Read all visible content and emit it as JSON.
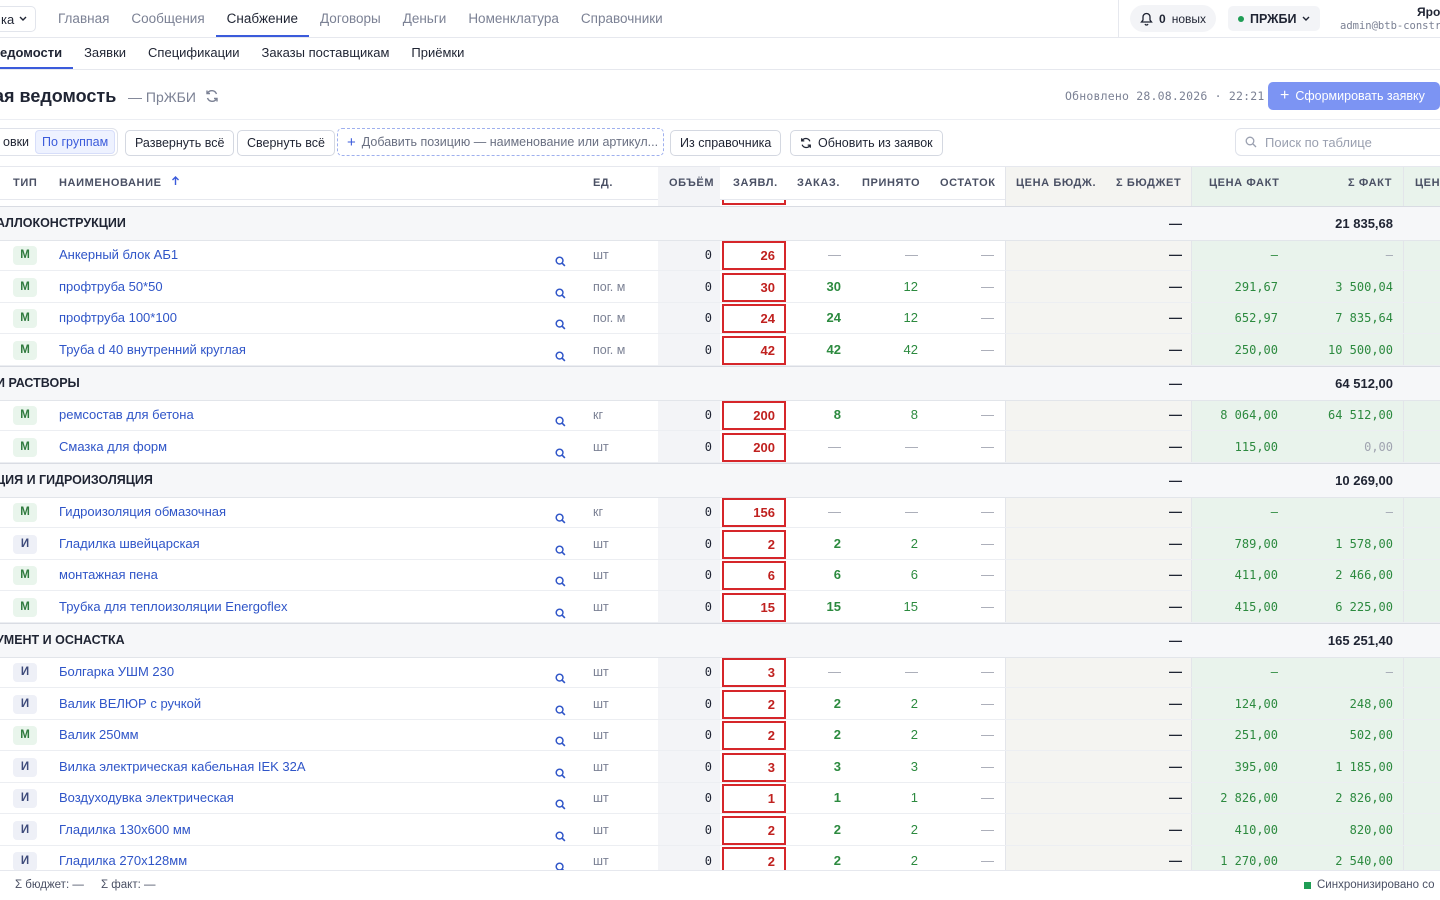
{
  "top_nav": {
    "project": "ка",
    "items": [
      "Главная",
      "Сообщения",
      "Снабжение",
      "Договоры",
      "Деньги",
      "Номенклатура",
      "Справочники"
    ],
    "active": "Снабжение",
    "notifications": {
      "count": "0",
      "label": "новых"
    },
    "org": "ПРЖБИ",
    "user_name": "Яро",
    "user_email": "admin@btb-constr"
  },
  "sub_nav": {
    "items": [
      "едомости",
      "Заявки",
      "Спецификации",
      "Заказы поставщикам",
      "Приёмки"
    ],
    "active": "едомости"
  },
  "header": {
    "title": "ая ведомость",
    "subtitle": "— ПрЖБИ",
    "updated_label": "Обновлено 28.08.2026 · 22:21",
    "primary_button": "Сформировать заявку"
  },
  "toolbar": {
    "group_toggle": [
      "овки",
      "По группам"
    ],
    "group_toggle_active": "По группам",
    "expand_all": "Развернуть всё",
    "collapse_all": "Свернуть всё",
    "add_placeholder": "Добавить позицию — наименование или артикул...",
    "from_catalog": "Из справочника",
    "update_from_requests": "Обновить из заявок",
    "search_placeholder": "Поиск по таблице"
  },
  "columns": {
    "type": "ТИП",
    "name": "НАИМЕНОВАНИЕ",
    "unit": "ЕД.",
    "volume": "ОБЪЁМ",
    "requested": "ЗАЯВЛ.",
    "ordered": "ЗАКАЗ.",
    "accepted": "ПРИНЯТО",
    "remainder": "ОСТАТОК",
    "price_budget": "ЦЕНА БЮДЖ.",
    "sum_budget": "Σ БЮДЖЕТ",
    "price_fact": "ЦЕНА ФАКТ",
    "sum_fact": "Σ ФАКТ",
    "price_next": "ЦЕН"
  },
  "groups": [
    {
      "name": "АЛЛОКОНСТРУКЦИИ",
      "budget": "—",
      "fact": "21 835,68",
      "rows": [
        {
          "type": "М",
          "name": "Анкерный блок АБ1",
          "unit": "шт",
          "volume": "0",
          "requested": "26",
          "ordered": "—",
          "accepted": "—",
          "remainder": "—",
          "budget": "—",
          "price_fact": "—",
          "sum_fact": "—"
        },
        {
          "type": "М",
          "name": "профтруба 50*50",
          "unit": "пог. м",
          "volume": "0",
          "requested": "30",
          "ordered": "30",
          "accepted": "12",
          "remainder": "—",
          "budget": "—",
          "price_fact": "291,67",
          "sum_fact": "3 500,04"
        },
        {
          "type": "М",
          "name": "профтруба 100*100",
          "unit": "пог. м",
          "volume": "0",
          "requested": "24",
          "ordered": "24",
          "accepted": "12",
          "remainder": "—",
          "budget": "—",
          "price_fact": "652,97",
          "sum_fact": "7 835,64"
        },
        {
          "type": "М",
          "name": "Труба d 40 внутренний круглая",
          "unit": "пог. м",
          "volume": "0",
          "requested": "42",
          "ordered": "42",
          "accepted": "42",
          "remainder": "—",
          "budget": "—",
          "price_fact": "250,00",
          "sum_fact": "10 500,00"
        }
      ]
    },
    {
      "name": "И РАСТВОРЫ",
      "budget": "—",
      "fact": "64 512,00",
      "rows": [
        {
          "type": "М",
          "name": "ремсостав для бетона",
          "unit": "кг",
          "volume": "0",
          "requested": "200",
          "ordered": "8",
          "accepted": "8",
          "remainder": "—",
          "budget": "—",
          "price_fact": "8 064,00",
          "sum_fact": "64 512,00"
        },
        {
          "type": "М",
          "name": "Смазка для форм",
          "unit": "шт",
          "volume": "0",
          "requested": "200",
          "ordered": "—",
          "accepted": "—",
          "remainder": "—",
          "budget": "—",
          "price_fact": "115,00",
          "sum_fact": "0,00"
        }
      ]
    },
    {
      "name": "ЦИЯ И ГИДРОИЗОЛЯЦИЯ",
      "budget": "—",
      "fact": "10 269,00",
      "rows": [
        {
          "type": "М",
          "name": "Гидроизоляция обмазочная",
          "unit": "кг",
          "volume": "0",
          "requested": "156",
          "ordered": "—",
          "accepted": "—",
          "remainder": "—",
          "budget": "—",
          "price_fact": "—",
          "sum_fact": "—"
        },
        {
          "type": "И",
          "name": "Гладилка швейцарская",
          "unit": "шт",
          "volume": "0",
          "requested": "2",
          "ordered": "2",
          "accepted": "2",
          "remainder": "—",
          "budget": "—",
          "price_fact": "789,00",
          "sum_fact": "1 578,00"
        },
        {
          "type": "М",
          "name": "монтажная пена",
          "unit": "шт",
          "volume": "0",
          "requested": "6",
          "ordered": "6",
          "accepted": "6",
          "remainder": "—",
          "budget": "—",
          "price_fact": "411,00",
          "sum_fact": "2 466,00"
        },
        {
          "type": "М",
          "name": "Трубка для теплоизоляции Energoflex",
          "unit": "шт",
          "volume": "0",
          "requested": "15",
          "ordered": "15",
          "accepted": "15",
          "remainder": "—",
          "budget": "—",
          "price_fact": "415,00",
          "sum_fact": "6 225,00"
        }
      ]
    },
    {
      "name": "УМЕНТ И ОСНАСТКА",
      "budget": "—",
      "fact": "165 251,40",
      "rows": [
        {
          "type": "И",
          "name": "Болгарка УШМ 230",
          "unit": "шт",
          "volume": "0",
          "requested": "3",
          "ordered": "—",
          "accepted": "—",
          "remainder": "—",
          "budget": "—",
          "price_fact": "—",
          "sum_fact": "—"
        },
        {
          "type": "И",
          "name": "Валик ВЕЛЮР с ручкой",
          "unit": "шт",
          "volume": "0",
          "requested": "2",
          "ordered": "2",
          "accepted": "2",
          "remainder": "—",
          "budget": "—",
          "price_fact": "124,00",
          "sum_fact": "248,00"
        },
        {
          "type": "М",
          "name": "Валик 250мм",
          "unit": "шт",
          "volume": "0",
          "requested": "2",
          "ordered": "2",
          "accepted": "2",
          "remainder": "—",
          "budget": "—",
          "price_fact": "251,00",
          "sum_fact": "502,00"
        },
        {
          "type": "И",
          "name": "Вилка электрическая кабельная IEK 32A",
          "unit": "шт",
          "volume": "0",
          "requested": "3",
          "ordered": "3",
          "accepted": "3",
          "remainder": "—",
          "budget": "—",
          "price_fact": "395,00",
          "sum_fact": "1 185,00"
        },
        {
          "type": "И",
          "name": "Воздуходувка электрическая",
          "unit": "шт",
          "volume": "0",
          "requested": "1",
          "ordered": "1",
          "accepted": "1",
          "remainder": "—",
          "budget": "—",
          "price_fact": "2 826,00",
          "sum_fact": "2 826,00"
        },
        {
          "type": "И",
          "name": "Гладилка 130x600 мм",
          "unit": "шт",
          "volume": "0",
          "requested": "2",
          "ordered": "2",
          "accepted": "2",
          "remainder": "—",
          "budget": "—",
          "price_fact": "410,00",
          "sum_fact": "820,00"
        },
        {
          "type": "И",
          "name": "Гладилка 270x128мм",
          "unit": "шт",
          "volume": "0",
          "requested": "2",
          "ordered": "2",
          "accepted": "2",
          "remainder": "—",
          "budget": "—",
          "price_fact": "1 270,00",
          "sum_fact": "2 540,00"
        }
      ]
    }
  ],
  "footer": {
    "sum_budget": "Σ бюджет: —",
    "sum_fact": "Σ факт: —",
    "sync_status": "Синхронизировано со"
  },
  "colors": {
    "accent": "#3b5bdb",
    "primary_button": "#7c94f3",
    "requested_border": "#d6262a",
    "positive": "#2c8a3f",
    "fact_band": "#e9f3ec"
  }
}
